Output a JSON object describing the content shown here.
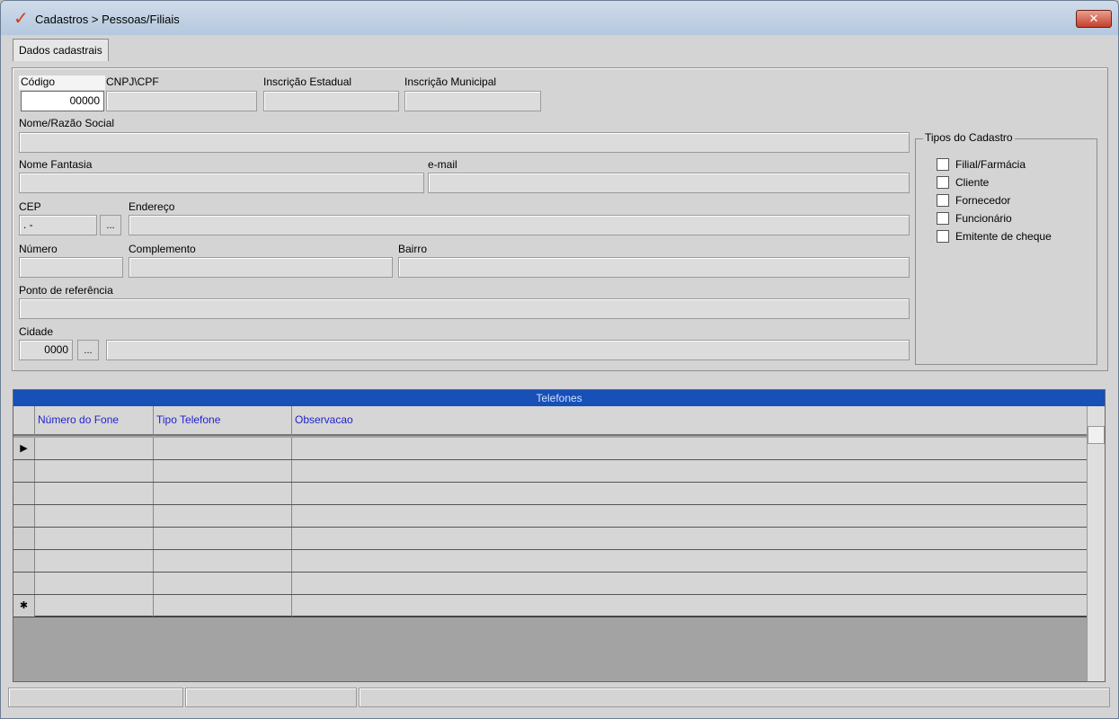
{
  "window": {
    "title": "Cadastros > Pessoas/Filiais",
    "close_label": "✕"
  },
  "tabs": [
    {
      "label": "Dados cadastrais"
    }
  ],
  "form": {
    "codigo": {
      "label": "Código",
      "value": "00000"
    },
    "cnpj": {
      "label": "CNPJ\\CPF",
      "value": ""
    },
    "inscricao_estadual": {
      "label": "Inscrição Estadual",
      "value": ""
    },
    "inscricao_municipal": {
      "label": "Inscrição Municipal",
      "value": ""
    },
    "nome_razao": {
      "label": "Nome/Razão Social",
      "value": ""
    },
    "nome_fantasia": {
      "label": "Nome Fantasia",
      "value": ""
    },
    "email": {
      "label": "e-mail",
      "value": ""
    },
    "cep": {
      "label": "CEP",
      "value": " .   - "
    },
    "endereco": {
      "label": "Endereço",
      "value": ""
    },
    "numero": {
      "label": "Número",
      "value": ""
    },
    "complemento": {
      "label": "Complemento",
      "value": ""
    },
    "bairro": {
      "label": "Bairro",
      "value": ""
    },
    "ponto_referencia": {
      "label": "Ponto de referência",
      "value": ""
    },
    "cidade": {
      "label": "Cidade",
      "code": "0000",
      "name": ""
    },
    "lookup_button": "..."
  },
  "tipos": {
    "title": "Tipos do Cadastro",
    "options": [
      {
        "label": "Filial/Farmácia",
        "checked": false
      },
      {
        "label": "Cliente",
        "checked": false
      },
      {
        "label": "Fornecedor",
        "checked": false
      },
      {
        "label": "Funcionário",
        "checked": false
      },
      {
        "label": "Emitente de cheque",
        "checked": false
      }
    ]
  },
  "telefones": {
    "title": "Telefones",
    "columns": [
      "Número do Fone",
      "Tipo Telefone",
      "Observacao"
    ],
    "current_row_marker": "▶",
    "new_row_marker": "✱"
  },
  "status": [
    "",
    "",
    ""
  ]
}
